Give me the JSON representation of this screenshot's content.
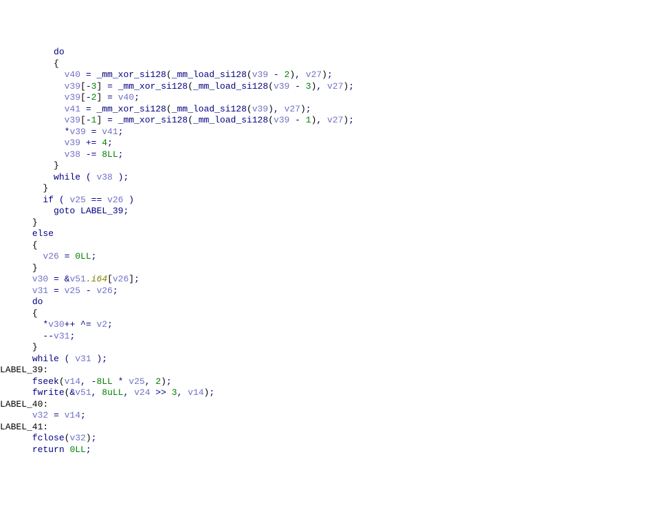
{
  "tokens": [
    [
      "          ",
      "kw",
      "do",
      "\n"
    ],
    [
      "          ",
      "pun",
      "{",
      "\n"
    ],
    [
      "            ",
      "var",
      "v40",
      "op",
      " = ",
      "fn",
      "_mm_xor_si128",
      "pun",
      "(",
      "fn",
      "_mm_load_si128",
      "pun",
      "(",
      "var",
      "v39",
      "op",
      " - ",
      "num",
      "2",
      "pun",
      ")",
      "op",
      ", ",
      "var",
      "v27",
      "pun",
      ")",
      "op",
      ";",
      "\n"
    ],
    [
      "            ",
      "var",
      "v39",
      "pun",
      "[",
      "op",
      "-",
      "num",
      "3",
      "pun",
      "]",
      "op",
      " = ",
      "fn",
      "_mm_xor_si128",
      "pun",
      "(",
      "fn",
      "_mm_load_si128",
      "pun",
      "(",
      "var",
      "v39",
      "op",
      " - ",
      "num",
      "3",
      "pun",
      ")",
      "op",
      ", ",
      "var",
      "v27",
      "pun",
      ")",
      "op",
      ";",
      "\n"
    ],
    [
      "            ",
      "var",
      "v39",
      "pun",
      "[",
      "op",
      "-",
      "num",
      "2",
      "pun",
      "]",
      "op",
      " = ",
      "var",
      "v40",
      "op",
      ";",
      "\n"
    ],
    [
      "            ",
      "var",
      "v41",
      "op",
      " = ",
      "fn",
      "_mm_xor_si128",
      "pun",
      "(",
      "fn",
      "_mm_load_si128",
      "pun",
      "(",
      "var",
      "v39",
      "pun",
      ")",
      "op",
      ", ",
      "var",
      "v27",
      "pun",
      ")",
      "op",
      ";",
      "\n"
    ],
    [
      "            ",
      "var",
      "v39",
      "pun",
      "[",
      "op",
      "-",
      "num",
      "1",
      "pun",
      "]",
      "op",
      " = ",
      "fn",
      "_mm_xor_si128",
      "pun",
      "(",
      "fn",
      "_mm_load_si128",
      "pun",
      "(",
      "var",
      "v39",
      "op",
      " - ",
      "num",
      "1",
      "pun",
      ")",
      "op",
      ", ",
      "var",
      "v27",
      "pun",
      ")",
      "op",
      ";",
      "\n"
    ],
    [
      "            ",
      "op",
      "*",
      "var",
      "v39",
      "op",
      " = ",
      "var",
      "v41",
      "op",
      ";",
      "\n"
    ],
    [
      "            ",
      "var",
      "v39",
      "op",
      " += ",
      "num",
      "4",
      "op",
      ";",
      "\n"
    ],
    [
      "            ",
      "var",
      "v38",
      "op",
      " -= ",
      "num",
      "8LL",
      "op",
      ";",
      "\n"
    ],
    [
      "          ",
      "pun",
      "}",
      "\n"
    ],
    [
      "          ",
      "kw",
      "while",
      "op",
      " ( ",
      "var",
      "v38",
      "op",
      " );",
      "\n"
    ],
    [
      "        ",
      "pun",
      "}",
      "\n"
    ],
    [
      "        ",
      "kw",
      "if",
      "op",
      " ( ",
      "var",
      "v25",
      "op",
      " == ",
      "var",
      "v26",
      "op",
      " )",
      "\n"
    ],
    [
      "          ",
      "kw",
      "goto",
      "op",
      " ",
      "fn",
      "LABEL_39",
      "op",
      ";",
      "\n"
    ],
    [
      "      ",
      "pun",
      "}",
      "\n"
    ],
    [
      "      ",
      "kw",
      "else",
      "\n"
    ],
    [
      "      ",
      "pun",
      "{",
      "\n"
    ],
    [
      "        ",
      "var",
      "v26",
      "op",
      " = ",
      "num",
      "0LL",
      "op",
      ";",
      "\n"
    ],
    [
      "      ",
      "pun",
      "}",
      "\n"
    ],
    [
      "      ",
      "var",
      "v30",
      "op",
      " = &",
      "var",
      "v51",
      "mem",
      ".i64",
      "pun",
      "[",
      "var",
      "v26",
      "pun",
      "]",
      "op",
      ";",
      "\n"
    ],
    [
      "      ",
      "var",
      "v31",
      "op",
      " = ",
      "var",
      "v25",
      "op",
      " - ",
      "var",
      "v26",
      "op",
      ";",
      "\n"
    ],
    [
      "      ",
      "kw",
      "do",
      "\n"
    ],
    [
      "      ",
      "pun",
      "{",
      "\n"
    ],
    [
      "        ",
      "op",
      "*",
      "var",
      "v30",
      "op",
      "++ ^= ",
      "var",
      "v2",
      "op",
      ";",
      "\n"
    ],
    [
      "        ",
      "op",
      "--",
      "var",
      "v31",
      "op",
      ";",
      "\n"
    ],
    [
      "      ",
      "pun",
      "}",
      "\n"
    ],
    [
      "      ",
      "kw",
      "while",
      "op",
      " ( ",
      "var",
      "v31",
      "op",
      " );",
      "\n"
    ],
    [
      "lbl",
      "LABEL_39:",
      "\n"
    ],
    [
      "      ",
      "fn",
      "fseek",
      "pun",
      "(",
      "var",
      "v14",
      "op",
      ", -",
      "num",
      "8LL",
      "op",
      " * ",
      "var",
      "v25",
      "op",
      ", ",
      "num",
      "2",
      "pun",
      ")",
      "op",
      ";",
      "\n"
    ],
    [
      "      ",
      "fn",
      "fwrite",
      "pun",
      "(",
      "op",
      "&",
      "var",
      "v51",
      "op",
      ", ",
      "num",
      "8uLL",
      "op",
      ", ",
      "var",
      "v24",
      "op",
      " >> ",
      "num",
      "3",
      "op",
      ", ",
      "var",
      "v14",
      "pun",
      ")",
      "op",
      ";",
      "\n"
    ],
    [
      "lbl",
      "LABEL_40:",
      "\n"
    ],
    [
      "      ",
      "var",
      "v32",
      "op",
      " = ",
      "var",
      "v14",
      "op",
      ";",
      "\n"
    ],
    [
      "lbl",
      "LABEL_41:",
      "\n"
    ],
    [
      "      ",
      "fn",
      "fclose",
      "pun",
      "(",
      "var",
      "v32",
      "pun",
      ")",
      "op",
      ";",
      "\n"
    ],
    [
      "      ",
      "kw",
      "return",
      "op",
      " ",
      "num",
      "0LL",
      "op",
      ";",
      "\n"
    ]
  ],
  "chart_data": {
    "type": "table",
    "title": "Decompiled C code snippet (IDA Hex-Rays style) — XOR decode loop and file write",
    "variables": [
      "v40",
      "v39",
      "v27",
      "v41",
      "v38",
      "v25",
      "v26",
      "v30",
      "v51",
      "v31",
      "v2",
      "v14",
      "v24",
      "v32"
    ],
    "functions": [
      "_mm_xor_si128",
      "_mm_load_si128",
      "fseek",
      "fwrite",
      "fclose"
    ],
    "labels": [
      "LABEL_39",
      "LABEL_40",
      "LABEL_41"
    ],
    "constants": [
      "2",
      "3",
      "1",
      "4",
      "8LL",
      "0LL",
      "8uLL",
      "-8LL"
    ]
  }
}
